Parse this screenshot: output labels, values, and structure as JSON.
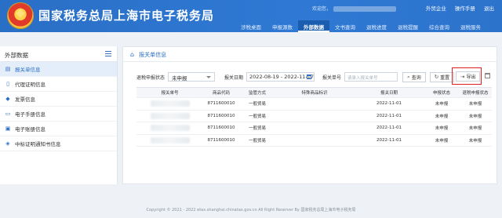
{
  "header": {
    "title": "国家税务总局上海市电子税务局",
    "welcome": "欢迎您，",
    "links": [
      "外贸企业",
      "操作手册",
      "退出"
    ],
    "nav": [
      "涉税桌面",
      "申报源数",
      "外部数据",
      "文书查询",
      "退税进度",
      "退税提醒",
      "综合查询",
      "退税服务"
    ],
    "active_nav_index": 2
  },
  "sidebar": {
    "title": "外部数据",
    "items": [
      {
        "label": "报关单信息",
        "icon": "list-icon",
        "active": true
      },
      {
        "label": "代理证明信息",
        "icon": "document-icon",
        "active": false
      },
      {
        "label": "发票信息",
        "icon": "tag-icon",
        "active": false
      },
      {
        "label": "电子手册信息",
        "icon": "book-icon",
        "active": false
      },
      {
        "label": "电子账册信息",
        "icon": "monitor-icon",
        "active": false
      },
      {
        "label": "中标证明通知书信息",
        "icon": "badge-icon",
        "active": false
      }
    ]
  },
  "main": {
    "breadcrumb": "报关单信息",
    "filters": {
      "status_label": "退税申报状态",
      "status_value": "未申报",
      "date_label": "报关日期",
      "date_value": "2022-08-19 - 2022-11-17",
      "decl_label": "报关单号",
      "decl_placeholder": "请录入报关单号"
    },
    "buttons": {
      "query": "查询",
      "reset": "重置",
      "export": "导出"
    }
  },
  "table": {
    "columns": [
      "报关单号",
      "商品代码",
      "监管方式",
      "特殊商品标识",
      "报关日期",
      "申报状态",
      "退税申报状态"
    ],
    "rows": [
      {
        "decl_no": "",
        "code": "8711600010",
        "method": "一般贸易",
        "special": "",
        "date": "2022-11-01",
        "status": "未申报",
        "refund_status": "未申报"
      },
      {
        "decl_no": "",
        "code": "8711600010",
        "method": "一般贸易",
        "special": "",
        "date": "2022-11-01",
        "status": "未申报",
        "refund_status": "未申报"
      },
      {
        "decl_no": "",
        "code": "8711600010",
        "method": "一般贸易",
        "special": "",
        "date": "2022-11-01",
        "status": "未申报",
        "refund_status": "未申报"
      },
      {
        "decl_no": "",
        "code": "8711600010",
        "method": "一般贸易",
        "special": "",
        "date": "2022-11-01",
        "status": "未申报",
        "refund_status": "未申报"
      }
    ]
  },
  "footer": "Copyright © 2021 - 2022 etax.shanghai.chinatax.gov.cn All Right Reserver By 国家税务总局上海市电子税务局",
  "colors": {
    "header_blue": "#2f79d4",
    "accent": "#2b6fc6",
    "export_highlight": "#e02020"
  }
}
